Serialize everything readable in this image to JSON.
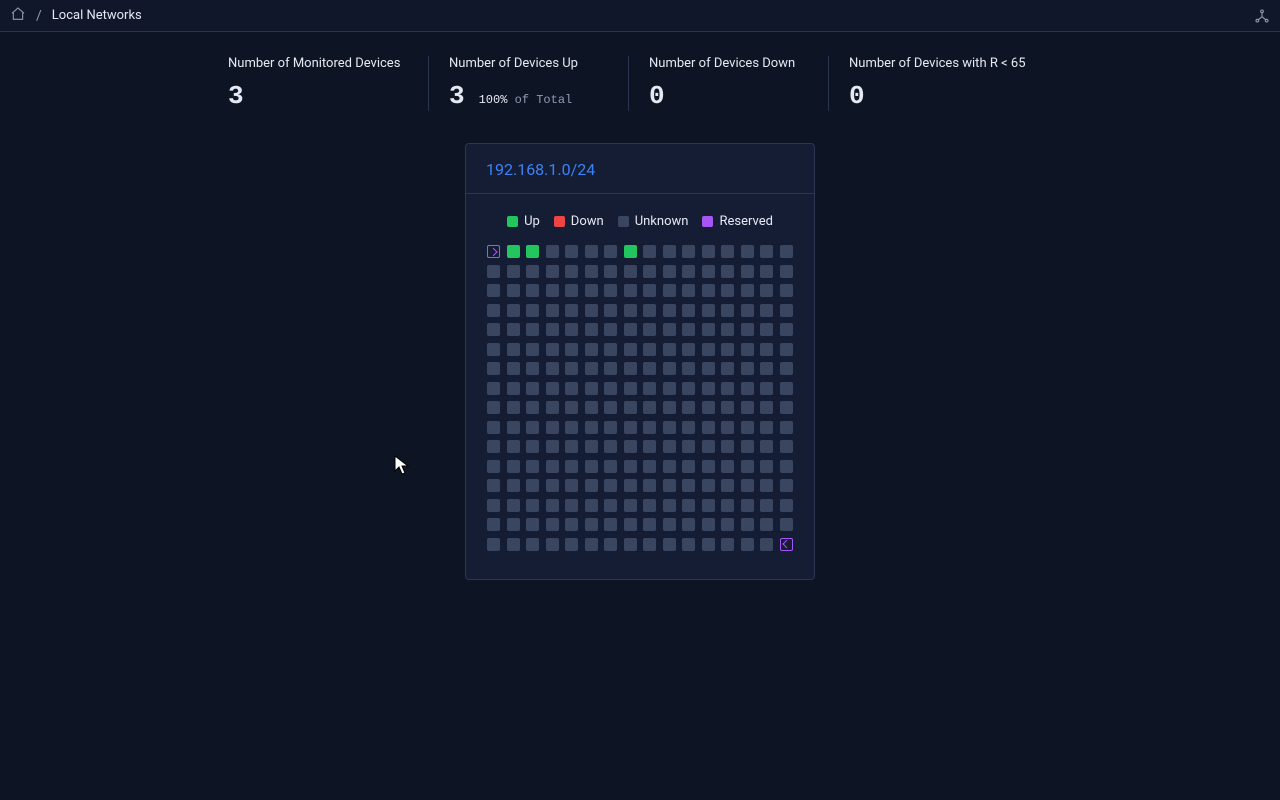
{
  "breadcrumb": {
    "current": "Local Networks"
  },
  "stats": [
    {
      "label": "Number of Monitored Devices",
      "value": "3"
    },
    {
      "label": "Number of Devices Up",
      "value": "3",
      "pct": "100%",
      "sub": "of Total"
    },
    {
      "label": "Number of Devices Down",
      "value": "0"
    },
    {
      "label": "Number of Devices with R < 65",
      "value": "0"
    }
  ],
  "network": {
    "title": "192.168.1.0/24",
    "legend": {
      "up": "Up",
      "down": "Down",
      "unknown": "Unknown",
      "reserved": "Reserved"
    },
    "up_indices": [
      1,
      2,
      7
    ],
    "reserved_indices": [
      0,
      255
    ],
    "size": 256
  },
  "colors": {
    "up": "#22c55e",
    "down": "#ef4444",
    "unknown": "#3a4560",
    "reserved": "#a855f7",
    "accent": "#3b82f6"
  }
}
